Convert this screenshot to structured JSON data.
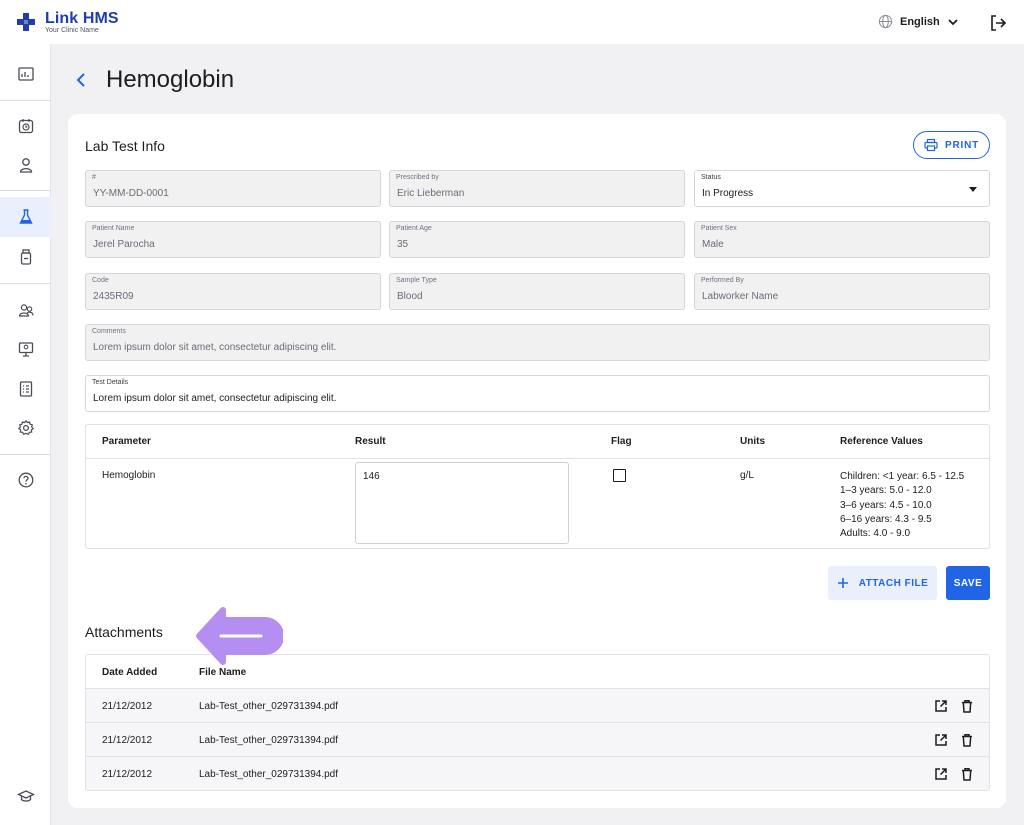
{
  "app": {
    "name": "Link HMS",
    "subtitle": "Your Clinic Name"
  },
  "header": {
    "language": "English"
  },
  "sidebar": {
    "items": [
      {
        "name": "dashboard-icon"
      },
      {
        "name": "appointments-icon"
      },
      {
        "name": "patient-icon"
      },
      {
        "name": "lab-flask-icon",
        "active": true
      },
      {
        "name": "medicine-bottle-icon"
      },
      {
        "name": "staff-icon"
      },
      {
        "name": "monitor-icon"
      },
      {
        "name": "reports-icon"
      },
      {
        "name": "settings-icon"
      },
      {
        "name": "help-icon"
      },
      {
        "name": "education-icon"
      }
    ]
  },
  "page": {
    "title": "Hemoglobin"
  },
  "lab_info": {
    "title": "Lab Test Info",
    "print_label": "PRINT",
    "fields": {
      "number": {
        "label": "#",
        "value": "YY-MM-DD-0001"
      },
      "prescribed_by": {
        "label": "Prescribed by",
        "value": "Eric Lieberman"
      },
      "status": {
        "label": "Status",
        "value": "In Progress"
      },
      "patient_name": {
        "label": "Patient Name",
        "value": "Jerel Parocha"
      },
      "patient_age": {
        "label": "Patient Age",
        "value": "35"
      },
      "patient_sex": {
        "label": "Patient Sex",
        "value": "Male"
      },
      "code": {
        "label": "Code",
        "value": "2435R09"
      },
      "sample_type": {
        "label": "Sample Type",
        "value": "Blood"
      },
      "performed_by": {
        "label": "Performed By",
        "value": "Labworker Name"
      },
      "comments": {
        "label": "Comments",
        "value": "Lorem ipsum dolor sit amet, consectetur adipiscing elit."
      },
      "test_details": {
        "label": "Test Details",
        "value": "Lorem ipsum dolor sit amet, consectetur adipiscing elit."
      }
    }
  },
  "params_table": {
    "headers": [
      "Parameter",
      "Result",
      "Flag",
      "Units",
      "Reference Values"
    ],
    "row": {
      "parameter": "Hemoglobin",
      "result": "146",
      "flag": false,
      "units": "g/L",
      "reference": [
        "Children: <1 year: 6.5 - 12.5",
        "1–3 years: 5.0 - 12.0",
        "3–6 years: 4.5 - 10.0",
        "6–16 years: 4.3 - 9.5",
        "Adults: 4.0 - 9.0"
      ]
    }
  },
  "actions": {
    "attach_label": "ATTACH FILE",
    "save_label": "SAVE"
  },
  "attachments": {
    "title": "Attachments",
    "headers": [
      "Date Added",
      "File Name"
    ],
    "rows": [
      {
        "date": "21/12/2012",
        "file": "Lab-Test_other_029731394.pdf"
      },
      {
        "date": "21/12/2012",
        "file": "Lab-Test_other_029731394.pdf"
      },
      {
        "date": "21/12/2012",
        "file": "Lab-Test_other_029731394.pdf"
      }
    ]
  },
  "colors": {
    "primary": "#2165e6",
    "brand": "#1f3ea8",
    "annotation_arrow": "#b48ef0"
  }
}
